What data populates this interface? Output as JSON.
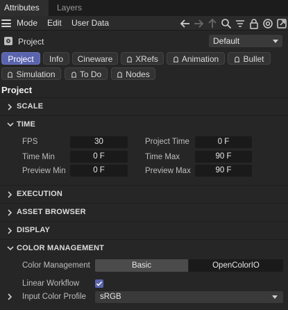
{
  "tabs": {
    "attributes": "Attributes",
    "layers": "Layers"
  },
  "menu": {
    "mode": "Mode",
    "edit": "Edit",
    "user_data": "User Data"
  },
  "toolbar": {
    "icons": [
      "back-arrow-icon",
      "forward-arrow-icon",
      "up-arrow-icon",
      "search-icon",
      "filter-icon",
      "lock-icon",
      "target-icon",
      "new-window-icon"
    ]
  },
  "object": {
    "label": "Project",
    "preset": "Default"
  },
  "pills": [
    {
      "label": "Project",
      "active": true
    },
    {
      "label": "Info"
    },
    {
      "label": "Cineware"
    },
    {
      "label": "XRefs",
      "lock": true
    },
    {
      "label": "Animation",
      "lock": true
    },
    {
      "label": "Bullet",
      "lock": true
    },
    {
      "label": "Simulation",
      "lock": true
    },
    {
      "label": "To Do",
      "lock": true
    },
    {
      "label": "Nodes",
      "lock": true
    }
  ],
  "section_title": "Project",
  "groups": {
    "scale": "SCALE",
    "time": "TIME",
    "execution": "EXECUTION",
    "asset_browser": "ASSET BROWSER",
    "display": "DISPLAY",
    "color_management": "COLOR MANAGEMENT"
  },
  "time": {
    "fps_label": "FPS",
    "fps_value": "30",
    "project_time_label": "Project Time",
    "project_time_value": "0 F",
    "time_min_label": "Time Min",
    "time_min_value": "0 F",
    "time_max_label": "Time Max",
    "time_max_value": "90 F",
    "preview_min_label": "Preview Min",
    "preview_min_value": "0 F",
    "preview_max_label": "Preview Max",
    "preview_max_value": "90 F"
  },
  "color": {
    "management_label": "Color Management",
    "option_basic": "Basic",
    "option_ocio": "OpenColorIO",
    "selected": "Basic",
    "linear_workflow_label": "Linear Workflow",
    "linear_workflow_checked": true,
    "input_profile_label": "Input Color Profile",
    "input_profile_value": "sRGB"
  },
  "colors": {
    "accent": "#5a64ad",
    "bg": "#262626",
    "field_bg": "#1a1a1a"
  }
}
